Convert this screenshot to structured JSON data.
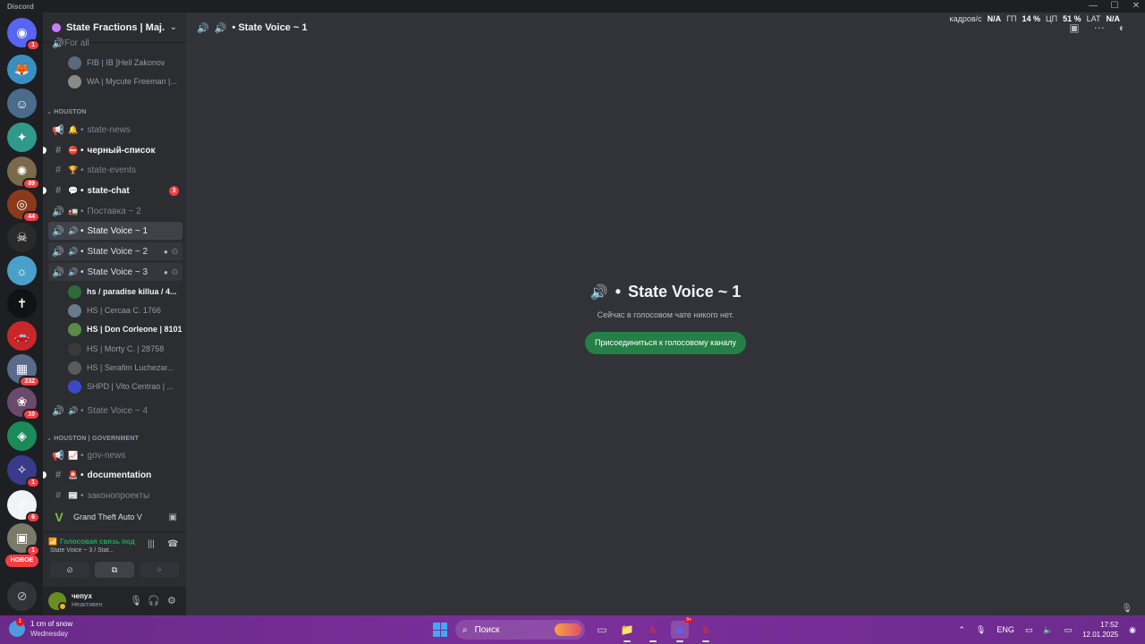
{
  "window": {
    "app_name": "Discord",
    "controls": [
      "—",
      "☐",
      "✕"
    ]
  },
  "server_rail": {
    "items": [
      {
        "name": "home",
        "color": "#5865f2",
        "glyph": "◉",
        "badge": "1"
      },
      {
        "name": "server-fox",
        "color": "#3a8fc2",
        "glyph": "🦊",
        "badge": ""
      },
      {
        "name": "server-man",
        "color": "#4a6b8a",
        "glyph": "☺",
        "badge": ""
      },
      {
        "name": "server-shield",
        "color": "#2f9a8a",
        "glyph": "✦",
        "badge": ""
      },
      {
        "name": "server-crowd",
        "color": "#7a6a4a",
        "glyph": "✺",
        "badge": "89"
      },
      {
        "name": "server-ring",
        "color": "#8a3a1a",
        "glyph": "◎",
        "badge": "44"
      },
      {
        "name": "server-rivera",
        "color": "#2a2a2a",
        "glyph": "☠",
        "badge": ""
      },
      {
        "name": "server-desert",
        "color": "#4aa0c8",
        "glyph": "☼",
        "badge": ""
      },
      {
        "name": "server-cross",
        "color": "#111214",
        "glyph": "✝",
        "badge": ""
      },
      {
        "name": "server-car",
        "color": "#c8282a",
        "glyph": "🚗",
        "badge": ""
      },
      {
        "name": "server-city",
        "color": "#5a6a8a",
        "glyph": "▦",
        "badge": "232"
      },
      {
        "name": "server-pink",
        "color": "#6a4a6a",
        "glyph": "❀",
        "badge": "10"
      },
      {
        "name": "server-alien",
        "color": "#1a8a5a",
        "glyph": "◈",
        "badge": ""
      },
      {
        "name": "server-sigil",
        "color": "#3a3a8a",
        "glyph": "✧",
        "badge": "1"
      },
      {
        "name": "server-e",
        "color": "#f2f3f5",
        "glyph": "ℯ",
        "badge": "6"
      },
      {
        "name": "server-town",
        "color": "#7a7a6a",
        "glyph": "▣",
        "badge": "1"
      }
    ],
    "new_label": "НОВОЕ"
  },
  "guild": {
    "name": "State Fractions | Maj..."
  },
  "channels_top": {
    "cut_channel": "For all",
    "users": [
      {
        "name": "FIB | IB ]Hell Zakonov",
        "avatar": "#5a6a7a"
      },
      {
        "name": "WA | Mycute Freeman |...",
        "avatar": "#8a8a8a"
      }
    ]
  },
  "category_houston": "HOUSTON",
  "channels": [
    {
      "icon": "📢",
      "emoji": "🔔",
      "name": "state-news",
      "state": ""
    },
    {
      "icon": "#",
      "emoji": "⛔",
      "name": "черный-список",
      "state": "unread"
    },
    {
      "icon": "#",
      "emoji": "🏆",
      "name": "state-events",
      "state": ""
    },
    {
      "icon": "#",
      "emoji": "💬",
      "name": "state-chat",
      "state": "unread",
      "badge": "3"
    },
    {
      "icon": "🔊",
      "emoji": "🚛",
      "name": "Поставка ~ 2",
      "state": ""
    },
    {
      "icon": "🔊",
      "emoji": "🔊",
      "name": "State Voice ~ 1",
      "state": "active"
    },
    {
      "icon": "🔊",
      "emoji": "🔊",
      "name": "State Voice ~ 2",
      "state": "hover"
    },
    {
      "icon": "🔊",
      "emoji": "🔊",
      "name": "State Voice ~ 3",
      "state": "hover"
    }
  ],
  "voice_users": [
    {
      "name": "hs / paradise killua / 4...",
      "avatar": "#2f6a3a",
      "bright": true
    },
    {
      "name": "HS | Cercaa C. 1766",
      "avatar": "#6a7a8a",
      "bright": false
    },
    {
      "name": "HS | Don Corleone | 8101",
      "avatar": "#5a8a4a",
      "bright": true
    },
    {
      "name": "HS | Morty C. | 28758",
      "avatar": "#3a3a3a",
      "bright": false
    },
    {
      "name": "HS | Serafim Luchezar...",
      "avatar": "#5a5a5a",
      "bright": false
    },
    {
      "name": "SHPD | Vito Centrao | ...",
      "avatar": "#3a4ac8",
      "bright": false
    }
  ],
  "channel_voice4": {
    "icon": "🔊",
    "emoji": "🔊",
    "name": "State Voice ~ 4"
  },
  "category_gov": "HOUSTON | GOVERNMENT",
  "gov_channels": [
    {
      "icon": "📢",
      "emoji": "📈",
      "name": "gov-news",
      "state": ""
    },
    {
      "icon": "#",
      "emoji": "🚨",
      "name": "documentation",
      "state": "unread"
    },
    {
      "icon": "#",
      "emoji": "📰",
      "name": "законопроекты",
      "state": ""
    }
  ],
  "activity": {
    "game": "Grand Theft Auto V",
    "logo": "V"
  },
  "voice_panel": {
    "title": "Голосовая связь под",
    "subtitle": "State Voice ~ 3 / Stat...",
    "buttons": [
      "⊘",
      "⧉",
      "⁘"
    ]
  },
  "user_panel": {
    "name": "чепух",
    "status": "Неактивен"
  },
  "main": {
    "channel_name": "State Voice ~ 1",
    "empty_title": "State Voice ~ 1",
    "empty_subtitle": "Сейчас в голосовом чате никого нет.",
    "join_label": "Присоединиться к голосовому каналу"
  },
  "stats": {
    "fps_label": "кадров/с",
    "fps": "N/A",
    "gpu_label": "ГП",
    "gpu": "14 %",
    "cpu_label": "ЦП",
    "cpu": "51 %",
    "lat_label": "LAT",
    "lat": "N/A"
  },
  "taskbar": {
    "weather_temp": "1 cm of snow",
    "weather_day": "Wednesday",
    "weather_badge": "1",
    "search_placeholder": "Поиск",
    "apps": [
      {
        "name": "taskview",
        "glyph": "▭",
        "color": "#cfcfcf"
      },
      {
        "name": "explorer",
        "glyph": "📁",
        "color": "#f3c623"
      },
      {
        "name": "app-figure",
        "glyph": "♞",
        "color": "#b0305a"
      },
      {
        "name": "discord",
        "glyph": "◉",
        "color": "#5865f2"
      },
      {
        "name": "app-figure-2",
        "glyph": "♞",
        "color": "#b0305a"
      }
    ],
    "discord_badge": "9+",
    "lang": "ENG",
    "time": "17:52",
    "date": "12.01.2025"
  }
}
